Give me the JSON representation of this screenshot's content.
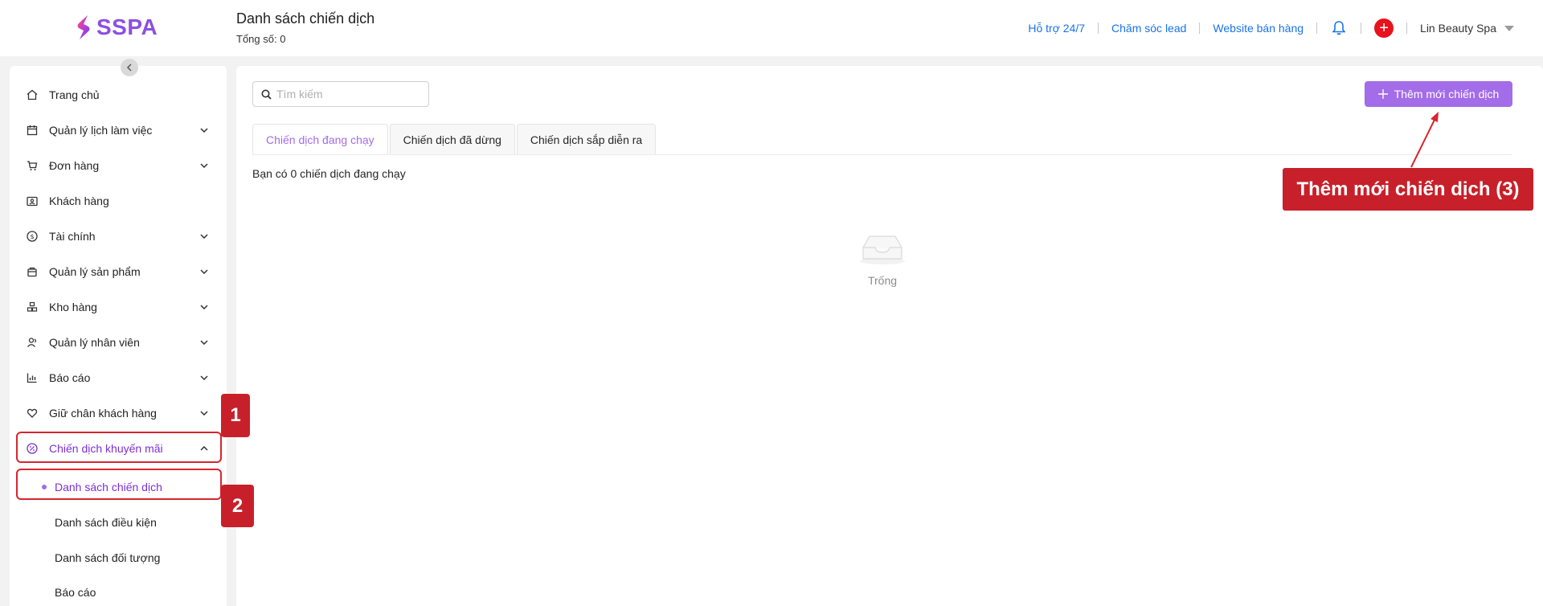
{
  "header": {
    "logo_text": "SSPA",
    "title": "Danh sách chiến dịch",
    "subtitle": "Tổng số: 0",
    "links": [
      "Hỗ trợ 24/7",
      "Chăm sóc lead",
      "Website bán hàng"
    ],
    "user": "Lin Beauty Spa"
  },
  "sidebar": {
    "items": [
      {
        "label": "Trang chủ",
        "icon": "home-icon",
        "expandable": false
      },
      {
        "label": "Quản lý lịch làm việc",
        "icon": "calendar-icon",
        "expandable": true
      },
      {
        "label": "Đơn hàng",
        "icon": "cart-icon",
        "expandable": true
      },
      {
        "label": "Khách hàng",
        "icon": "contact-card-icon",
        "expandable": false
      },
      {
        "label": "Tài chính",
        "icon": "dollar-icon",
        "expandable": true
      },
      {
        "label": "Quản lý sản phẩm",
        "icon": "box-icon",
        "expandable": true
      },
      {
        "label": "Kho hàng",
        "icon": "warehouse-icon",
        "expandable": true
      },
      {
        "label": "Quản lý nhân viên",
        "icon": "staff-icon",
        "expandable": true
      },
      {
        "label": "Báo cáo",
        "icon": "chart-icon",
        "expandable": true
      },
      {
        "label": "Giữ chân khách hàng",
        "icon": "heart-icon",
        "expandable": true
      },
      {
        "label": "Chiến dịch khuyến mãi",
        "icon": "percent-icon",
        "expandable": true,
        "active": true
      }
    ],
    "sub_items": [
      {
        "label": "Danh sách chiến dịch",
        "active": true
      },
      {
        "label": "Danh sách điều kiện"
      },
      {
        "label": "Danh sách đối tượng"
      },
      {
        "label": "Báo cáo"
      }
    ]
  },
  "main": {
    "search_placeholder": "Tìm kiếm",
    "add_button": "Thêm mới chiến dịch",
    "tabs": [
      {
        "label": "Chiến dịch đang chạy",
        "active": true
      },
      {
        "label": "Chiến dịch đã dừng"
      },
      {
        "label": "Chiến dịch sắp diễn ra"
      }
    ],
    "count_text": "Bạn có 0 chiến dịch đang chạy",
    "empty_text": "Trống"
  },
  "annotations": {
    "badge_1": "1",
    "badge_2": "2",
    "badge_3": "Thêm mới chiến dịch (3)"
  },
  "colors": {
    "accent": "#a36ce8",
    "active_text": "#7b2fd6",
    "link": "#1a73e8",
    "annotation_red": "#c8202a"
  }
}
